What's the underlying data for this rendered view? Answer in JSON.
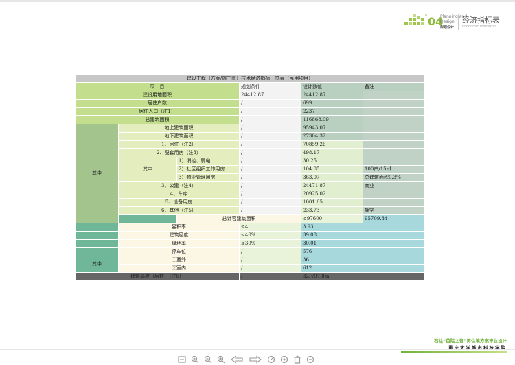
{
  "header": {
    "logo_number": "04",
    "logo_sub_1": "Planning and",
    "logo_sub_2": "Design",
    "logo_sub_3": "规划设计",
    "section_title": "经济指标表",
    "section_title_en": "Economic Indicators",
    "accent_color": "#8dbb3a"
  },
  "table": {
    "title": "建设工程（方案/施工图）技术经济指标一览表（民用项目）",
    "headers": {
      "item": "项　目",
      "planning": "规划条件",
      "design": "设计数值",
      "note": "备注"
    },
    "rows": {
      "site_area": {
        "label": "建设用地面积",
        "planning": "24412.87",
        "design": "24412.87",
        "note": ""
      },
      "households": {
        "label": "居住户数",
        "planning": "/",
        "design": "699"
      },
      "population": {
        "label": "居住人口（注1）",
        "planning": "/",
        "design": "2237"
      },
      "total_gfa": {
        "label": "总建筑面积",
        "planning": "/",
        "design": "116868.09"
      },
      "group_label": "其中",
      "above_ground": {
        "label": "地上建筑面积",
        "planning": "/",
        "design": "95943.07"
      },
      "underground": {
        "label": "地下建筑面积",
        "planning": "/",
        "design": "27304.32"
      },
      "residential": {
        "label": "1、居住（注2）",
        "planning": "/",
        "design": "70859.26"
      },
      "supporting": {
        "label": "2、配套用房（注3）",
        "planning": "/",
        "design": "498.17"
      },
      "sub_group_label": "其中",
      "fire_control": {
        "label": "1）消控、弱电",
        "planning": "/",
        "design": "30.25"
      },
      "community": {
        "label": "2）社区组织工作用房",
        "planning": "/",
        "design": "104.85",
        "note": "100户/15㎡"
      },
      "property_mgmt": {
        "label": "3）物业管理用房",
        "planning": "/",
        "design": "363.07",
        "note": "总建筑面积0.3%"
      },
      "public": {
        "label": "3、公建（注4）",
        "planning": "/",
        "design": "24471.87",
        "note": "商业"
      },
      "garage": {
        "label": "4、车库",
        "planning": "/",
        "design": "20925.02"
      },
      "equipment": {
        "label": "5、设备用房",
        "planning": "/",
        "design": "1001.65"
      },
      "other": {
        "label": "6、其他（注5）",
        "planning": "/",
        "design": "233.73",
        "note": "架空"
      },
      "far_total": {
        "label": "总计容建筑面积",
        "planning": "≤97600",
        "design": "95709.34"
      },
      "far": {
        "label": "容积率",
        "planning": "≤4",
        "design": "3.93"
      },
      "coverage": {
        "label": "建筑密度",
        "planning": "≤40%",
        "design": "39.08"
      },
      "green": {
        "label": "绿地率",
        "planning": "≤30%",
        "design": "30.01"
      },
      "parking": {
        "label": "停车位",
        "planning": "/",
        "design": "576"
      },
      "parking_group_label": "其中",
      "parking_out": {
        "label": "①室外",
        "planning": "/",
        "design": "36"
      },
      "parking_in": {
        "label": "②室内",
        "planning": "/",
        "design": "612"
      },
      "height": {
        "label": "建筑高度（层数）（注6）",
        "planning": "/",
        "design": "32F/97.8m"
      }
    }
  },
  "footer": {
    "line1": "石柱“芭院之音”再住境方案毕业设计",
    "line2": "重庆大学城市科技学院"
  },
  "toolbar": {
    "items": [
      "fit-page-icon",
      "zoom-in-icon",
      "zoom-out-icon",
      "zoom-fit-icon",
      "prev-icon",
      "next-icon",
      "rotate-icon",
      "settings-icon",
      "delete-icon",
      "more-icon"
    ]
  }
}
